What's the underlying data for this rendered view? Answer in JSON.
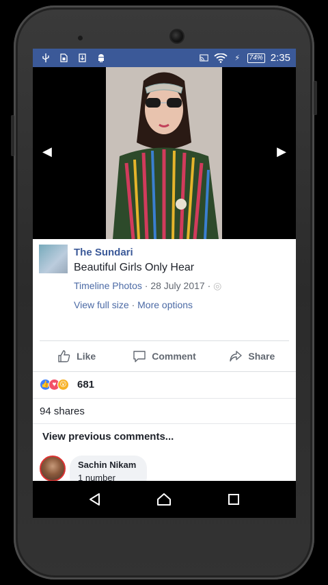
{
  "status_bar": {
    "icons": [
      "usb-icon",
      "sim-icon",
      "download-icon",
      "android-icon"
    ],
    "right_icons": [
      "cast-icon",
      "wifi-icon",
      "charging-icon"
    ],
    "battery": "74%",
    "time": "2:35",
    "color": "#3b5998"
  },
  "viewer": {
    "prev_icon": "chevron-left-icon",
    "next_icon": "chevron-right-icon"
  },
  "post": {
    "page_name": "The Sundari",
    "text": "Beautiful Girls Only Hear",
    "album": "Timeline Photos",
    "date": "28 July 2017",
    "view_full_size": "View full size",
    "more_options": "More options"
  },
  "actions": {
    "like": "Like",
    "comment": "Comment",
    "share": "Share"
  },
  "reactions": {
    "count": "681",
    "types": [
      "like",
      "love",
      "wow"
    ]
  },
  "shares": "94 shares",
  "comments": {
    "view_previous": "View previous comments...",
    "items": [
      {
        "name": "Sachin Nikam",
        "text": "1 number"
      }
    ]
  },
  "nav": [
    "back-icon",
    "home-icon",
    "recents-icon"
  ]
}
